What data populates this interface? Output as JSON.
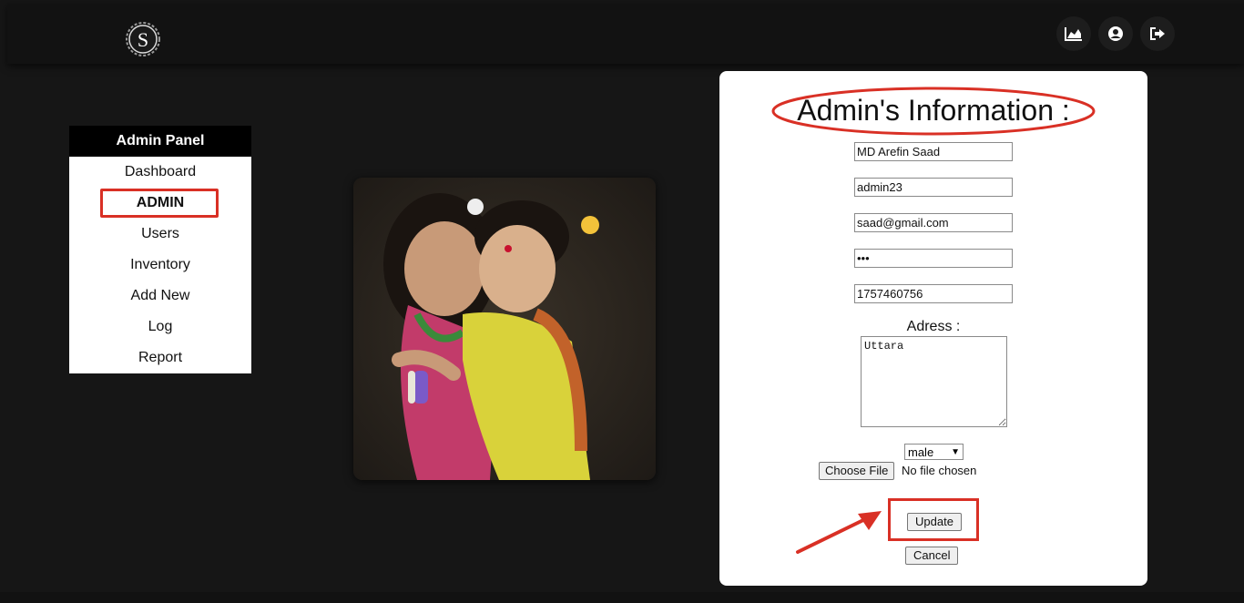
{
  "header": {
    "logo_letter": "S",
    "icons": [
      "chart-area-icon",
      "user-circle-icon",
      "sign-out-icon"
    ]
  },
  "sidebar": {
    "title": "Admin Panel",
    "items": [
      {
        "label": "Dashboard"
      },
      {
        "label": "ADMIN",
        "active": true
      },
      {
        "label": "Users"
      },
      {
        "label": "Inventory"
      },
      {
        "label": "Add New"
      },
      {
        "label": "Log"
      },
      {
        "label": "Report"
      }
    ]
  },
  "form": {
    "title": "Admin's Information :",
    "name": "MD Arefin Saad",
    "username": "admin23",
    "email": "saad@gmail.com",
    "password": "•••",
    "phone": "1757460756",
    "address_label": "Adress :",
    "address": "Uttara",
    "gender": "male",
    "choose_file": "Choose File",
    "no_file": "No file chosen",
    "update": "Update",
    "cancel": "Cancel"
  },
  "colors": {
    "background": "#161616",
    "highlight": "#d93025"
  }
}
